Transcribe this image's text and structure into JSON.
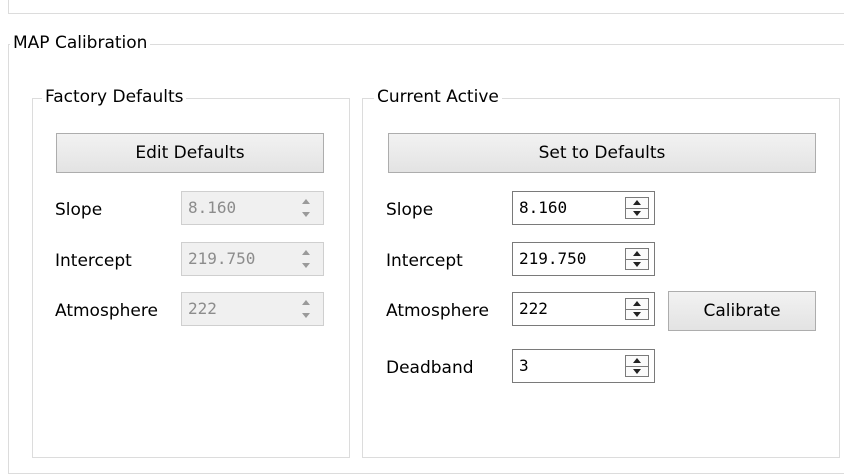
{
  "map_calibration": {
    "title": "MAP Calibration",
    "factory_defaults": {
      "title": "Factory Defaults",
      "edit_button": "Edit Defaults",
      "slope": {
        "label": "Slope",
        "value": "8.160"
      },
      "intercept": {
        "label": "Intercept",
        "value": "219.750"
      },
      "atmosphere": {
        "label": "Atmosphere",
        "value": "222"
      }
    },
    "current_active": {
      "title": "Current Active",
      "set_defaults_button": "Set to Defaults",
      "slope": {
        "label": "Slope",
        "value": "8.160"
      },
      "intercept": {
        "label": "Intercept",
        "value": "219.750"
      },
      "atmosphere": {
        "label": "Atmosphere",
        "value": "222"
      },
      "calibrate_button": "Calibrate",
      "deadband": {
        "label": "Deadband",
        "value": "3"
      }
    }
  }
}
